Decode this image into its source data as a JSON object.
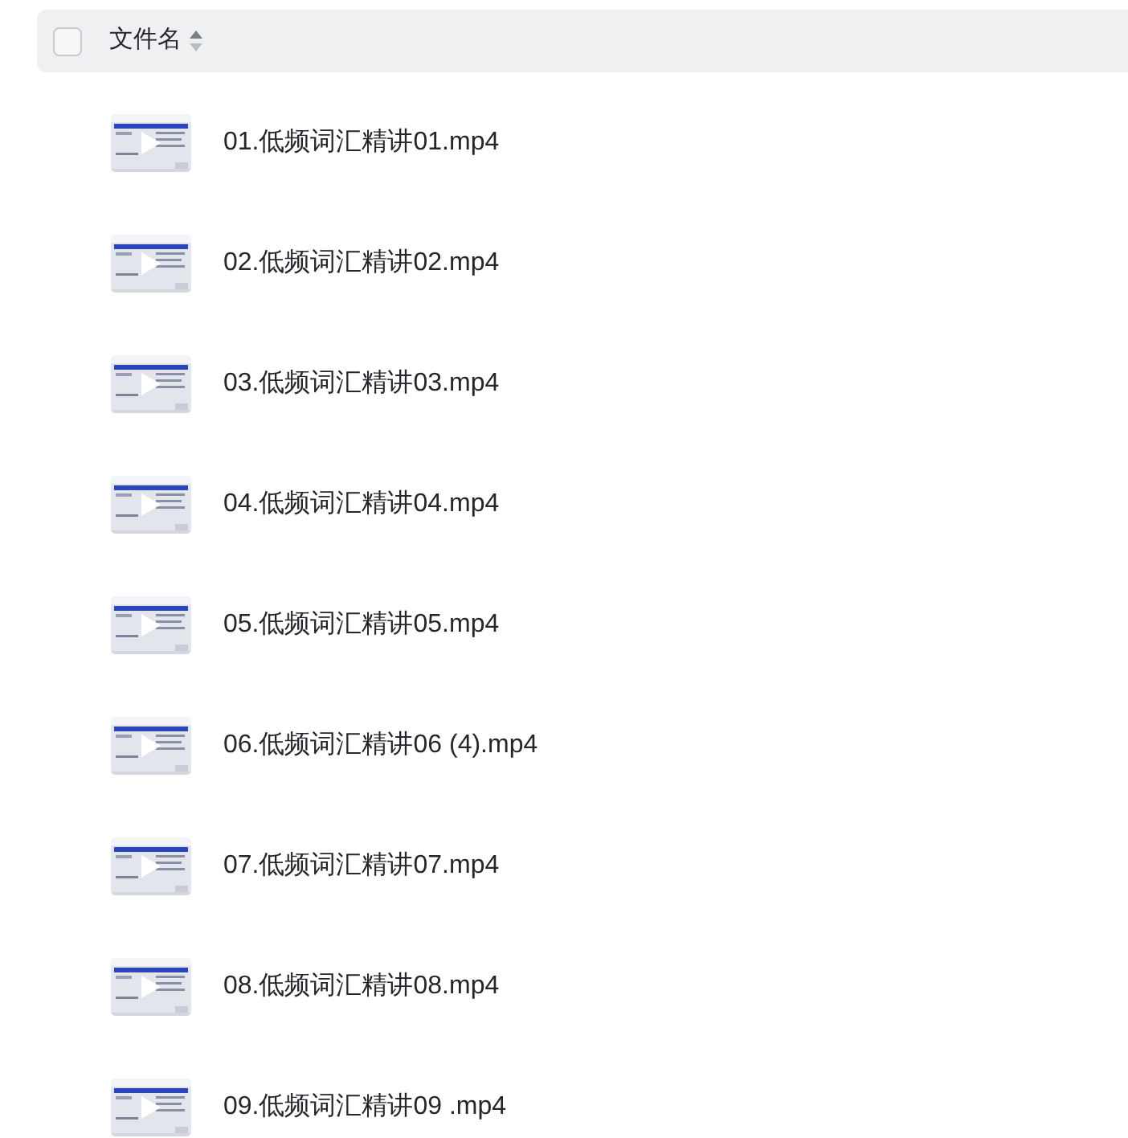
{
  "header": {
    "select_all_checked": false,
    "column_label": "文件名"
  },
  "files": [
    {
      "kind": "video",
      "name": "01.低频词汇精讲01.mp4"
    },
    {
      "kind": "video",
      "name": "02.低频词汇精讲02.mp4"
    },
    {
      "kind": "video",
      "name": "03.低频词汇精讲03.mp4"
    },
    {
      "kind": "video",
      "name": "04.低频词汇精讲04.mp4"
    },
    {
      "kind": "video",
      "name": "05.低频词汇精讲05.mp4"
    },
    {
      "kind": "video",
      "name": "06.低频词汇精讲06 (4).mp4"
    },
    {
      "kind": "video",
      "name": "07.低频词汇精讲07.mp4"
    },
    {
      "kind": "video",
      "name": "08.低频词汇精讲08.mp4"
    },
    {
      "kind": "video",
      "name": "09.低频词汇精讲09 .mp4"
    }
  ]
}
